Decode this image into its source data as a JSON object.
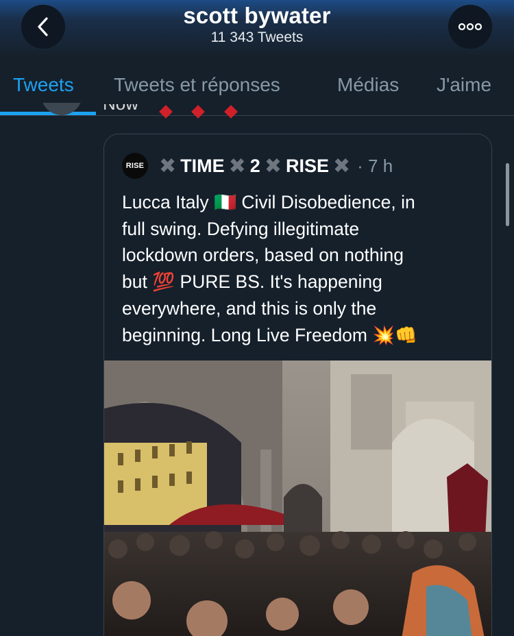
{
  "header": {
    "title": "scott bywater",
    "subtitle": "11 343 Tweets",
    "back_icon": "chevron-left-icon",
    "more_icon": "more-horizontal-icon"
  },
  "tabs": [
    {
      "label": "Tweets",
      "active": true
    },
    {
      "label": "Tweets et réponses",
      "active": false
    },
    {
      "label": "Médias",
      "active": false
    },
    {
      "label": "J'aime",
      "active": false
    }
  ],
  "previous_tweet": {
    "partial_text": "Now"
  },
  "quoted_tweet": {
    "avatar_label": "RISE",
    "name_parts": [
      "TIME",
      "2",
      "RISE"
    ],
    "time": "· 7 h",
    "text_lines": [
      "Lucca Italy 🇮🇹 Civil Disobedience, in",
      "full swing. Defying illegitimate",
      "lockdown orders, based on nothing",
      "but 💯 PURE BS. It's happening",
      "everywhere, and this is only the",
      "beginning. Long Live Freedom 💥👊"
    ]
  },
  "colors": {
    "background": "#15202b",
    "accent": "#1da1f2",
    "muted": "#8899a6",
    "border": "#38444d"
  }
}
